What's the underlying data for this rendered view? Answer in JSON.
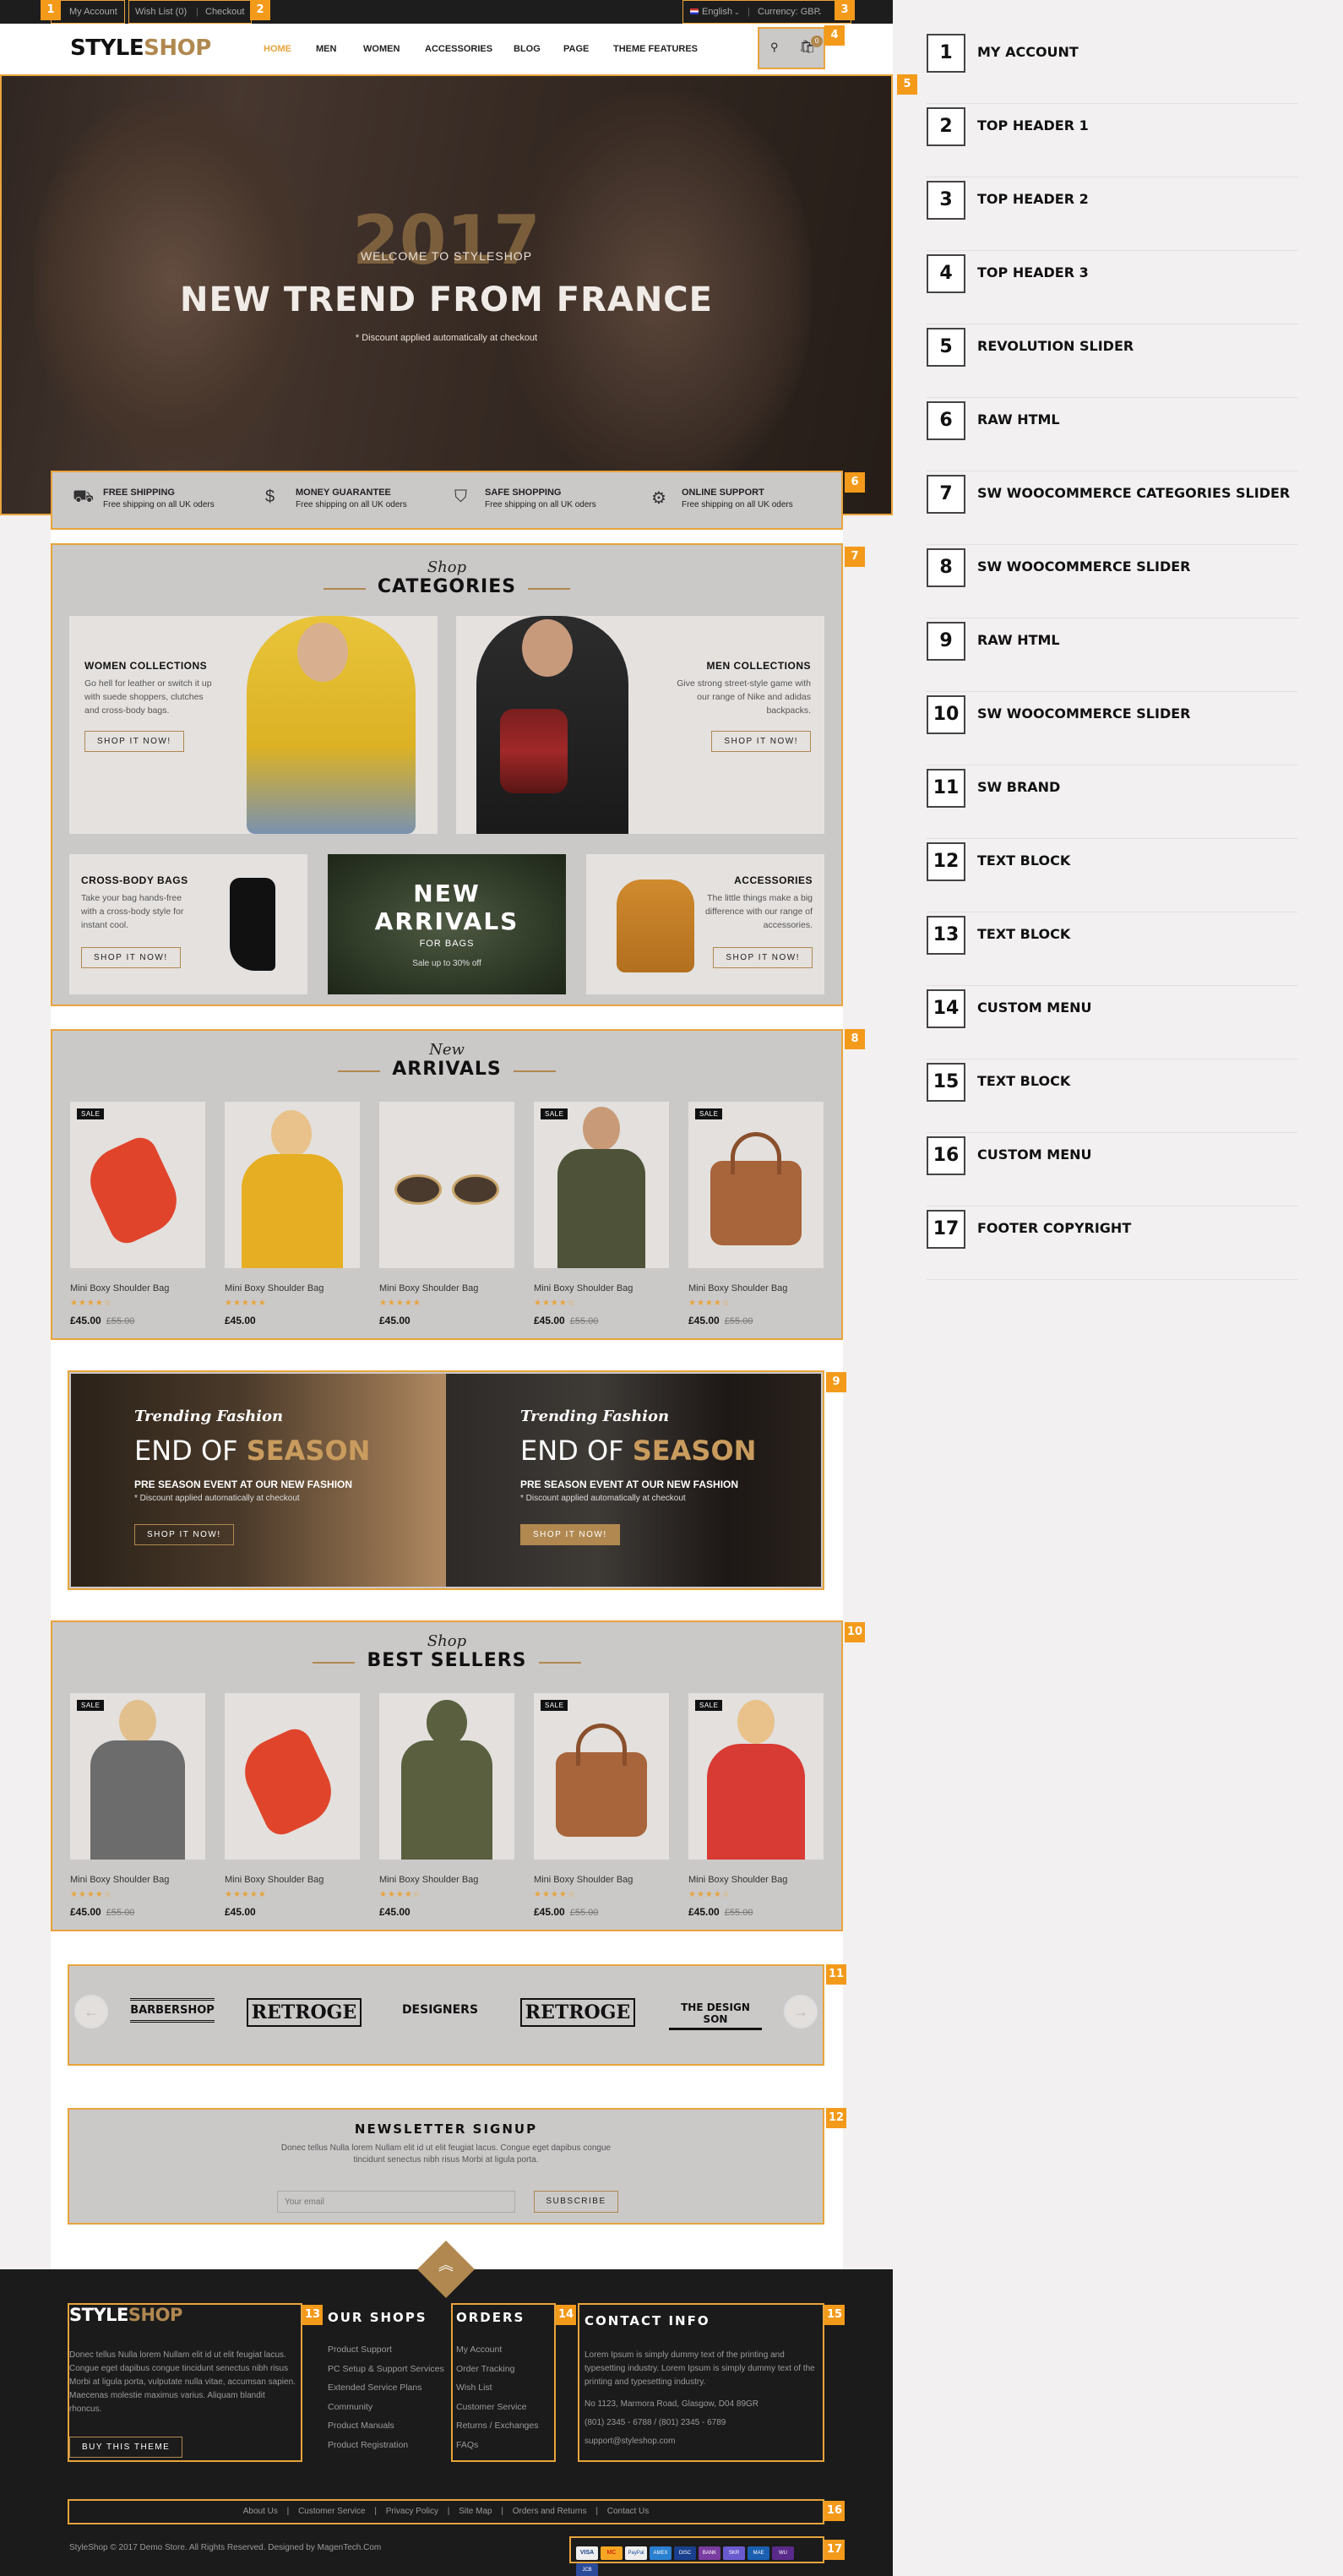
{
  "topbar": {
    "my_account": "My Account",
    "wishlist": "Wish List (0)",
    "checkout": "Checkout",
    "language": "English",
    "currency": "Currency: GBP"
  },
  "header": {
    "logo_part1": "STYLE",
    "logo_part2": "SHOP",
    "nav": [
      "HOME",
      "MEN",
      "WOMEN",
      "ACCESSORIES",
      "BLOG",
      "PAGE",
      "THEME FEATURES"
    ],
    "cart_count": "0"
  },
  "hero": {
    "year": "2017",
    "welcome": "WELCOME TO STYLESHOP",
    "headline": "NEW TREND FROM FRANCE",
    "sub": "* Discount applied automatically at checkout"
  },
  "features": [
    {
      "title": "FREE SHIPPING",
      "desc": "Free shipping on all UK oders",
      "icon": "truck-icon"
    },
    {
      "title": "MONEY GUARANTEE",
      "desc": "Free shipping on all UK oders",
      "icon": "money-icon"
    },
    {
      "title": "SAFE SHOPPING",
      "desc": "Free shipping on all UK oders",
      "icon": "shield-icon"
    },
    {
      "title": "ONLINE SUPPORT",
      "desc": "Free shipping on all UK oders",
      "icon": "gears-icon"
    }
  ],
  "categories": {
    "script": "Shop",
    "title": "CATEGORIES",
    "women": {
      "title": "WOMEN COLLECTIONS",
      "desc": "Go hell for leather or switch it up with suede shoppers, clutches and cross-body bags.",
      "btn": "SHOP IT NOW!"
    },
    "men": {
      "title": "MEN COLLECTIONS",
      "desc": "Give strong street-style game with our range of Nike and adidas backpacks.",
      "btn": "SHOP IT NOW!"
    },
    "crossbody": {
      "title": "CROSS-BODY BAGS",
      "desc": "Take your bag hands-free with a cross-body style for instant cool.",
      "btn": "SHOP IT NOW!"
    },
    "arrivals": {
      "line1": "NEW",
      "line2": "ARRIVALS",
      "line3": "FOR BAGS",
      "line4": "Sale up to 30% off"
    },
    "accessories": {
      "title": "ACCESSORIES",
      "desc": "The little things make a big difference with our range of accessories.",
      "btn": "SHOP IT NOW!"
    }
  },
  "new_arrivals": {
    "script": "New",
    "title": "ARRIVALS",
    "products": [
      {
        "name": "Mini Boxy Shoulder Bag",
        "stars": "★★★★☆",
        "price": "£45.00",
        "old": "£55.00",
        "sale": "SALE"
      },
      {
        "name": "Mini Boxy Shoulder Bag",
        "stars": "★★★★★",
        "price": "£45.00",
        "old": "",
        "sale": ""
      },
      {
        "name": "Mini Boxy Shoulder Bag",
        "stars": "★★★★★",
        "price": "£45.00",
        "old": "",
        "sale": ""
      },
      {
        "name": "Mini Boxy Shoulder Bag",
        "stars": "★★★★☆",
        "price": "£45.00",
        "old": "£55.00",
        "sale": "SALE"
      },
      {
        "name": "Mini Boxy Shoulder Bag",
        "stars": "★★★★☆",
        "price": "£45.00",
        "old": "£55.00",
        "sale": "SALE"
      }
    ]
  },
  "banners": [
    {
      "script": "Trending Fashion",
      "title1": "END OF ",
      "title2": "SEASON",
      "line": "PRE SEASON EVENT AT OUR NEW FASHION",
      "sub": "* Discount applied automatically at checkout",
      "btn": "SHOP IT NOW!"
    },
    {
      "script": "Trending Fashion",
      "title1": "END OF ",
      "title2": "SEASON",
      "line": "PRE SEASON EVENT AT OUR NEW FASHION",
      "sub": "* Discount applied automatically at checkout",
      "btn": "SHOP IT NOW!"
    }
  ],
  "best_sellers": {
    "script": "Shop",
    "title": "BEST SELLERS",
    "products": [
      {
        "name": "Mini Boxy Shoulder Bag",
        "stars": "★★★★☆",
        "price": "£45.00",
        "old": "£55.00",
        "sale": "SALE"
      },
      {
        "name": "Mini Boxy Shoulder Bag",
        "stars": "★★★★★",
        "price": "£45.00",
        "old": "",
        "sale": ""
      },
      {
        "name": "Mini Boxy Shoulder Bag",
        "stars": "★★★★☆",
        "price": "£45.00",
        "old": "",
        "sale": ""
      },
      {
        "name": "Mini Boxy Shoulder Bag",
        "stars": "★★★★☆",
        "price": "£45.00",
        "old": "£55.00",
        "sale": "SALE"
      },
      {
        "name": "Mini Boxy Shoulder Bag",
        "stars": "★★★★☆",
        "price": "£45.00",
        "old": "£55.00",
        "sale": "SALE"
      }
    ]
  },
  "brands": [
    "BARBERSHOP",
    "RETROGE",
    "DESIGNERS",
    "RETROGE",
    "THE DESIGN SON"
  ],
  "newsletter": {
    "title": "NEWSLETTER SIGNUP",
    "desc1": "Donec tellus Nulla lorem Nullam elit id ut elit feugiat lacus. Congue eget dapibus congue",
    "desc2": "tincidunt senectus nibh risus Morbi at ligula porta.",
    "placeholder": "Your email",
    "btn": "SUBSCRIBE"
  },
  "footer": {
    "logo_part1": "STYLE",
    "logo_part2": "SHOP",
    "about": "Donec tellus Nulla lorem Nullam elit id ut elit feugiat lacus. Congue eget dapibus congue tincidunt senectus nibh risus Morbi at ligula porta, vulputate nulla vitae, accumsan sapien. Maecenas molestie maximus varius. Aliquam blandit rhoncus.",
    "buy_btn": "BUY THIS THEME",
    "shops_title": "OUR SHOPS",
    "shops": [
      "Product Support",
      "PC Setup & Support Services",
      "Extended Service Plans",
      "Community",
      "Product Manuals",
      "Product Registration"
    ],
    "orders_title": "ORDERS",
    "orders": [
      "My Account",
      "Order Tracking",
      "Wish List",
      "Customer Service",
      "Returns / Exchanges",
      "FAQs"
    ],
    "contact_title": "CONTACT INFO",
    "contact_desc": "Lorem Ipsum is simply dummy text of the printing and typesetting industry. Lorem Ipsum is simply dummy text of the printing and typesetting industry.",
    "address": "No 1123, Marmora Road, Glasgow, D04 89GR",
    "phone": "(801) 2345 - 6788 / (801) 2345 - 6789",
    "email": "support@styleshop.com",
    "menu": [
      "About Us",
      "Customer Service",
      "Privacy Policy",
      "Site Map",
      "Orders and Returns",
      "Contact Us"
    ],
    "copyright": "StyleShop © 2017 Demo Store. All Rights Reserved. Designed by MagenTech.Com",
    "payments": [
      "VISA",
      "MC",
      "PayPal",
      "AMEX",
      "DISC",
      "BANK",
      "SKR",
      "MAE",
      "WU",
      "JCB"
    ]
  },
  "panel": [
    {
      "n": "1",
      "label": "MY ACCOUNT"
    },
    {
      "n": "2",
      "label": "TOP HEADER 1"
    },
    {
      "n": "3",
      "label": "TOP HEADER 2"
    },
    {
      "n": "4",
      "label": "TOP HEADER 3"
    },
    {
      "n": "5",
      "label": "REVOLUTION SLIDER"
    },
    {
      "n": "6",
      "label": "RAW HTML"
    },
    {
      "n": "7",
      "label": "SW WOOCOMMERCE CATEGORIES SLIDER"
    },
    {
      "n": "8",
      "label": "SW WOOCOMMERCE SLIDER"
    },
    {
      "n": "9",
      "label": "RAW HTML"
    },
    {
      "n": "10",
      "label": "SW WOOCOMMERCE SLIDER"
    },
    {
      "n": "11",
      "label": "SW BRAND"
    },
    {
      "n": "12",
      "label": "TEXT BLOCK"
    },
    {
      "n": "13",
      "label": "TEXT BLOCK"
    },
    {
      "n": "14",
      "label": "CUSTOM MENU"
    },
    {
      "n": "15",
      "label": "TEXT BLOCK"
    },
    {
      "n": "16",
      "label": "CUSTOM MENU"
    },
    {
      "n": "17",
      "label": "FOOTER COPYRIGHT"
    }
  ],
  "badges": [
    "1",
    "2",
    "3",
    "4",
    "5",
    "6",
    "7",
    "8",
    "9",
    "10",
    "11",
    "12",
    "13",
    "14",
    "15",
    "16",
    "17"
  ],
  "colors": {
    "accent": "#e8a43c",
    "brand_gold": "#b08850",
    "dark": "#1b1b1b",
    "highlight_gray": "#cbc8c8"
  }
}
